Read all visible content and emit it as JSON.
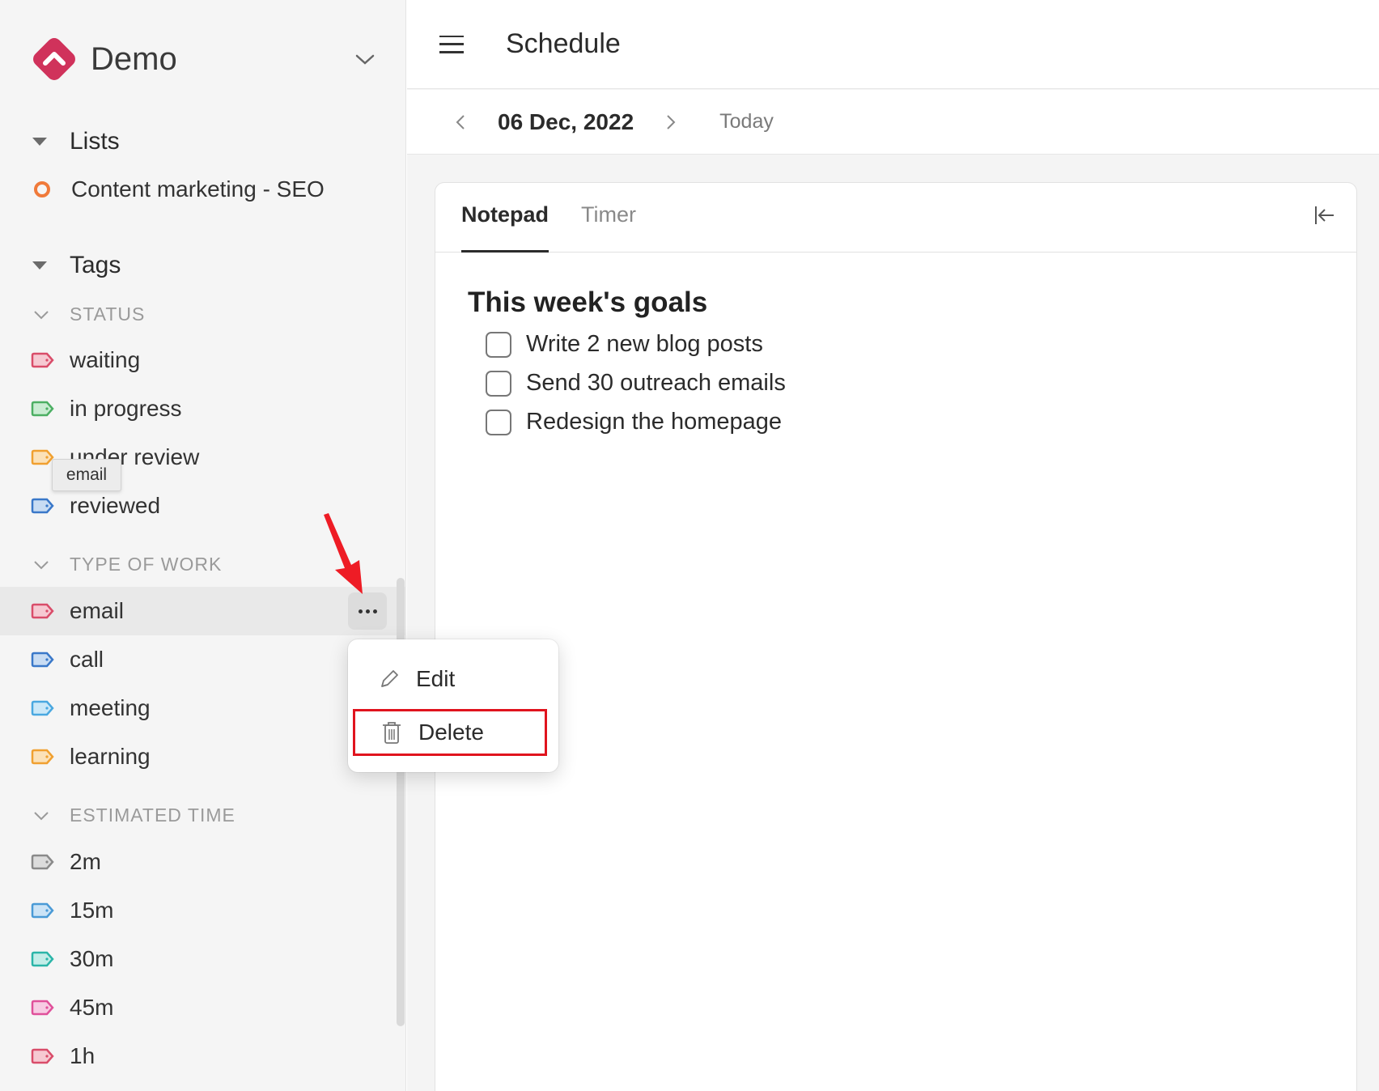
{
  "workspace": {
    "name": "Demo",
    "logo_color": "#d0325b"
  },
  "sidebar": {
    "lists_label": "Lists",
    "lists": [
      {
        "label": "Content marketing - SEO",
        "color": "#f07a3a"
      }
    ],
    "tags_label": "Tags",
    "groups": [
      {
        "label": "STATUS",
        "tags": [
          {
            "label": "waiting",
            "color": "#d94d6a"
          },
          {
            "label": "in progress",
            "color": "#4caf63"
          },
          {
            "label": "under review",
            "color": "#f0a030"
          },
          {
            "label": "reviewed",
            "color": "#3a78c9"
          }
        ]
      },
      {
        "label": "TYPE OF WORK",
        "tags": [
          {
            "label": "email",
            "color": "#d94d6a"
          },
          {
            "label": "call",
            "color": "#3a78c9"
          },
          {
            "label": "meeting",
            "color": "#4aa8e0"
          },
          {
            "label": "learning",
            "color": "#f0a030"
          }
        ]
      },
      {
        "label": "ESTIMATED TIME",
        "tags": [
          {
            "label": "2m",
            "color": "#8a8a8a"
          },
          {
            "label": "15m",
            "color": "#4a9ad6"
          },
          {
            "label": "30m",
            "color": "#2bb5a8"
          },
          {
            "label": "45m",
            "color": "#e0509a"
          },
          {
            "label": "1h",
            "color": "#d94d6a"
          }
        ]
      }
    ],
    "tooltip": "email"
  },
  "context_menu": {
    "edit_label": "Edit",
    "delete_label": "Delete"
  },
  "header": {
    "title": "Schedule"
  },
  "datebar": {
    "date": "06 Dec, 2022",
    "today_label": "Today"
  },
  "panel": {
    "tabs": [
      "Notepad",
      "Timer"
    ],
    "active_tab": "Notepad",
    "heading": "This week's goals",
    "todos": [
      "Write 2 new blog posts",
      "Send 30 outreach emails",
      "Redesign the homepage"
    ]
  }
}
